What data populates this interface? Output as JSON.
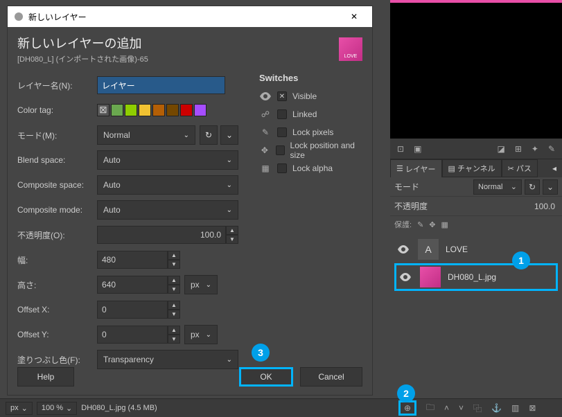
{
  "dialog": {
    "window_title": "新しいレイヤー",
    "title": "新しいレイヤーの追加",
    "subtitle": "[DH080_L] (インポートされた画像)-65",
    "fields": {
      "layer_name_label": "レイヤー名(N):",
      "layer_name_value": "レイヤー",
      "color_tag_label": "Color tag:",
      "mode_label": "モード(M):",
      "mode_value": "Normal",
      "blend_space_label": "Blend space:",
      "blend_space_value": "Auto",
      "composite_space_label": "Composite space:",
      "composite_space_value": "Auto",
      "composite_mode_label": "Composite mode:",
      "composite_mode_value": "Auto",
      "opacity_label": "不透明度(O):",
      "opacity_value": "100.0",
      "width_label": "幅:",
      "width_value": "480",
      "height_label": "高さ:",
      "height_value": "640",
      "size_unit": "px",
      "offset_x_label": "Offset X:",
      "offset_x_value": "0",
      "offset_y_label": "Offset Y:",
      "offset_y_value": "0",
      "offset_unit": "px",
      "fill_label": "塗りつぶし色(F):",
      "fill_value": "Transparency"
    },
    "color_tags": [
      "#555",
      "#6aa84f",
      "#8fce00",
      "#f1c232",
      "#b45f06",
      "#744700",
      "#cc0000",
      "#a64dff"
    ],
    "switches": {
      "title": "Switches",
      "visible": "Visible",
      "linked": "Linked",
      "lock_pixels": "Lock pixels",
      "lock_position": "Lock position and size",
      "lock_alpha": "Lock alpha"
    },
    "buttons": {
      "help": "Help",
      "ok": "OK",
      "cancel": "Cancel"
    }
  },
  "thumb_label": "LOVE",
  "callouts": {
    "c1": "1",
    "c2": "2",
    "c3": "3"
  },
  "panel": {
    "tabs": {
      "layers": "レイヤー",
      "channels": "チャンネル",
      "paths": "パス"
    },
    "mode_label": "モード",
    "mode_value": "Normal",
    "opacity_label": "不透明度",
    "opacity_value": "100.0",
    "protect_label": "保護:",
    "layers": [
      {
        "name": "LOVE",
        "type": "text"
      },
      {
        "name": "DH080_L.jpg",
        "type": "image"
      }
    ]
  },
  "status": {
    "unit": "px",
    "zoom": "100 %",
    "file": "DH080_L.jpg (4.5 MB)"
  }
}
